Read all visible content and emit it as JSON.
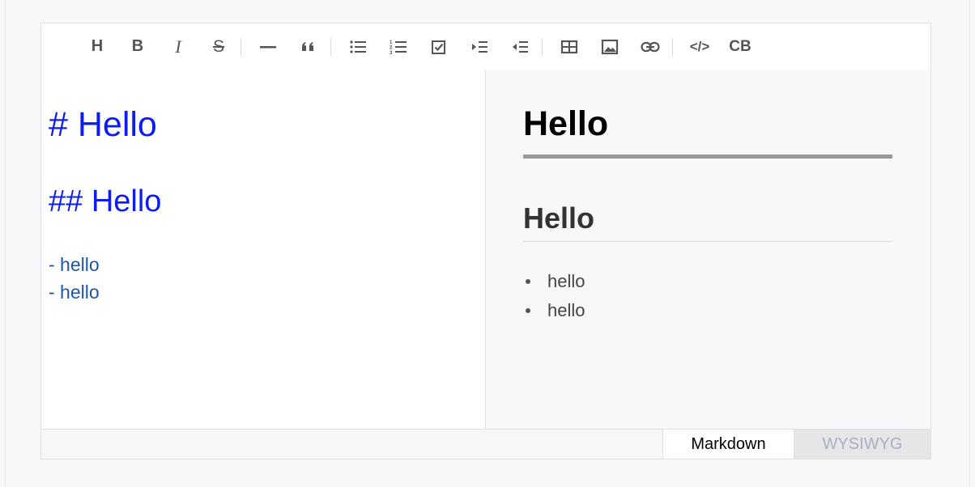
{
  "toolbar": {
    "buttons": [
      {
        "name": "heading",
        "label": "H",
        "icon": "heading-icon"
      },
      {
        "name": "bold",
        "label": "B",
        "icon": "bold-icon"
      },
      {
        "name": "italic",
        "label": "I",
        "icon": "italic-icon"
      },
      {
        "name": "strike",
        "label": "S",
        "icon": "strikethrough-icon"
      },
      {
        "name": "hr",
        "icon": "horizontal-rule-icon"
      },
      {
        "name": "quote",
        "icon": "quote-icon"
      },
      {
        "name": "ul",
        "icon": "bullet-list-icon"
      },
      {
        "name": "ol",
        "icon": "numbered-list-icon"
      },
      {
        "name": "task",
        "icon": "task-list-icon"
      },
      {
        "name": "indent",
        "icon": "indent-icon"
      },
      {
        "name": "outdent",
        "icon": "outdent-icon"
      },
      {
        "name": "table",
        "icon": "table-icon"
      },
      {
        "name": "image",
        "icon": "image-icon"
      },
      {
        "name": "link",
        "icon": "link-icon"
      },
      {
        "name": "code",
        "label": "</>",
        "icon": "code-icon"
      },
      {
        "name": "codeblock",
        "label": "CB",
        "icon": "codeblock-icon"
      }
    ]
  },
  "markdown": {
    "lines": [
      "# Hello",
      "## Hello",
      "- hello",
      "- hello"
    ]
  },
  "preview": {
    "h1": "Hello",
    "h2": "Hello",
    "list": [
      "hello",
      "hello"
    ]
  },
  "footer": {
    "tabs": [
      {
        "label": "Markdown",
        "active": true
      },
      {
        "label": "WYSIWYG",
        "active": false
      }
    ]
  },
  "colors": {
    "md_heading": "#0d1cf0",
    "md_list": "#1f55a6",
    "preview_bg": "#f7f8fa",
    "inactive_tab_text": "#a9b0c2"
  }
}
